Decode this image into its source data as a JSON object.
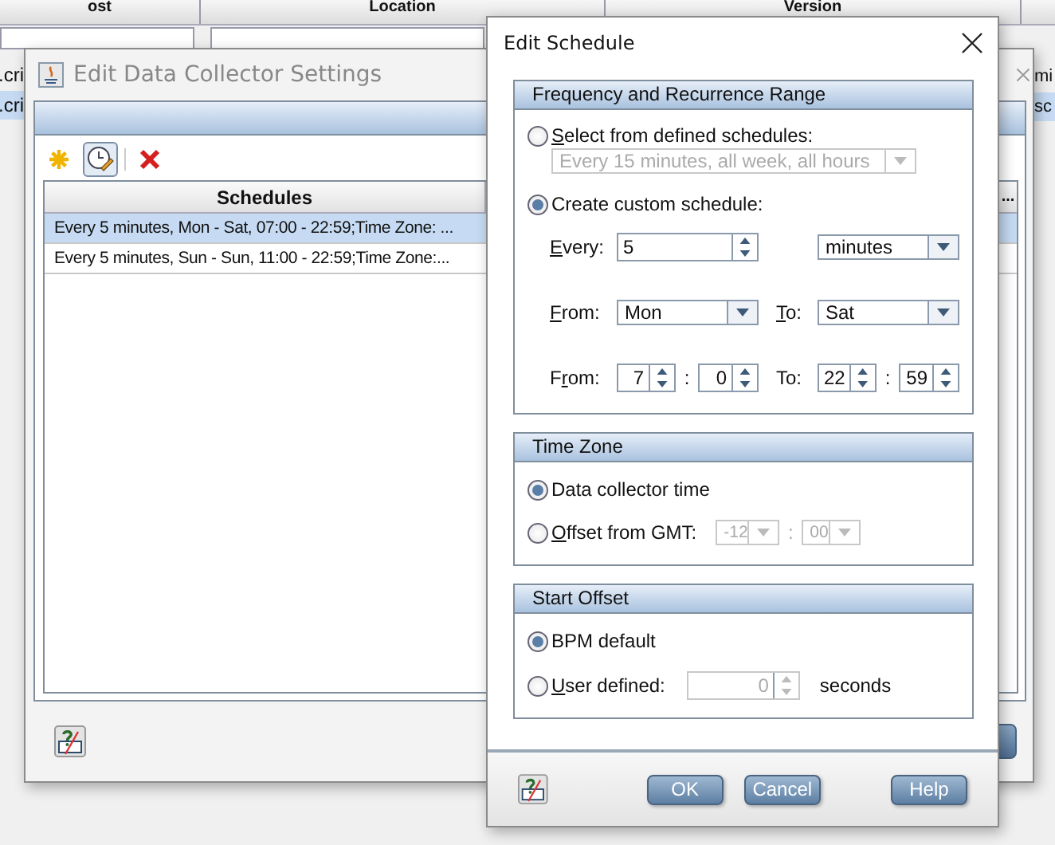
{
  "background_table": {
    "columns": [
      "ost",
      "Location",
      "Version"
    ],
    "rows": [
      {
        "column_1": ".cri",
        "column_4": "mi",
        "selected": false
      },
      {
        "column_1": ".cri",
        "column_4": "sc",
        "selected": true
      }
    ]
  },
  "settings_dialog": {
    "title": "Edit Data Collector Settings",
    "toolbar": [
      {
        "kind": "new",
        "pressed": false
      },
      {
        "kind": "edit",
        "pressed": true
      },
      {
        "kind": "delete",
        "pressed": false
      }
    ],
    "table": {
      "columns": [
        "Schedules",
        "..."
      ],
      "rows": [
        {
          "text": "Every 5 minutes, Mon - Sat, 07:00 - 22:59;Time Zone: ...",
          "selected": true
        },
        {
          "text": "Every 5 minutes, Sun - Sun, 11:00 - 22:59;Time Zone:...",
          "selected": false
        }
      ]
    }
  },
  "schedule_dialog": {
    "title": "Edit Schedule",
    "frequency": {
      "title": "Frequency and Recurrence Range",
      "defined": {
        "label": "Select from defined schedules:",
        "selected": false,
        "value": "Every 15 minutes, all week, all hours",
        "disabled": true
      },
      "custom": {
        "label": "Create custom schedule:",
        "selected": true
      },
      "every": {
        "label": "Every:",
        "value": "5",
        "unit": "minutes"
      },
      "days": {
        "from_label": "From:",
        "from": "Mon",
        "to_label": "To:",
        "to": "Sat"
      },
      "hours": {
        "from_label": "From:",
        "from_hour": "7",
        "from_separator": ":",
        "from_minute": "0",
        "to_label": "To:",
        "to_hour": "22",
        "to_separator": ":",
        "to_minute": "59"
      }
    },
    "time_zone": {
      "title": "Time Zone",
      "options": [
        {
          "label": "Data collector time",
          "selected": true
        },
        {
          "label": "Offset from GMT:",
          "selected": false
        }
      ],
      "offset_hours": "-12",
      "separator": ":",
      "offset_minutes": "00",
      "disabled": true
    },
    "start_offset": {
      "title": "Start Offset",
      "options": [
        {
          "label": "BPM default",
          "selected": true
        },
        {
          "label": "User defined:",
          "selected": false
        }
      ],
      "value": "0",
      "unit": "seconds",
      "disabled": true
    },
    "buttons": [
      "OK",
      "Cancel",
      "Help"
    ]
  }
}
